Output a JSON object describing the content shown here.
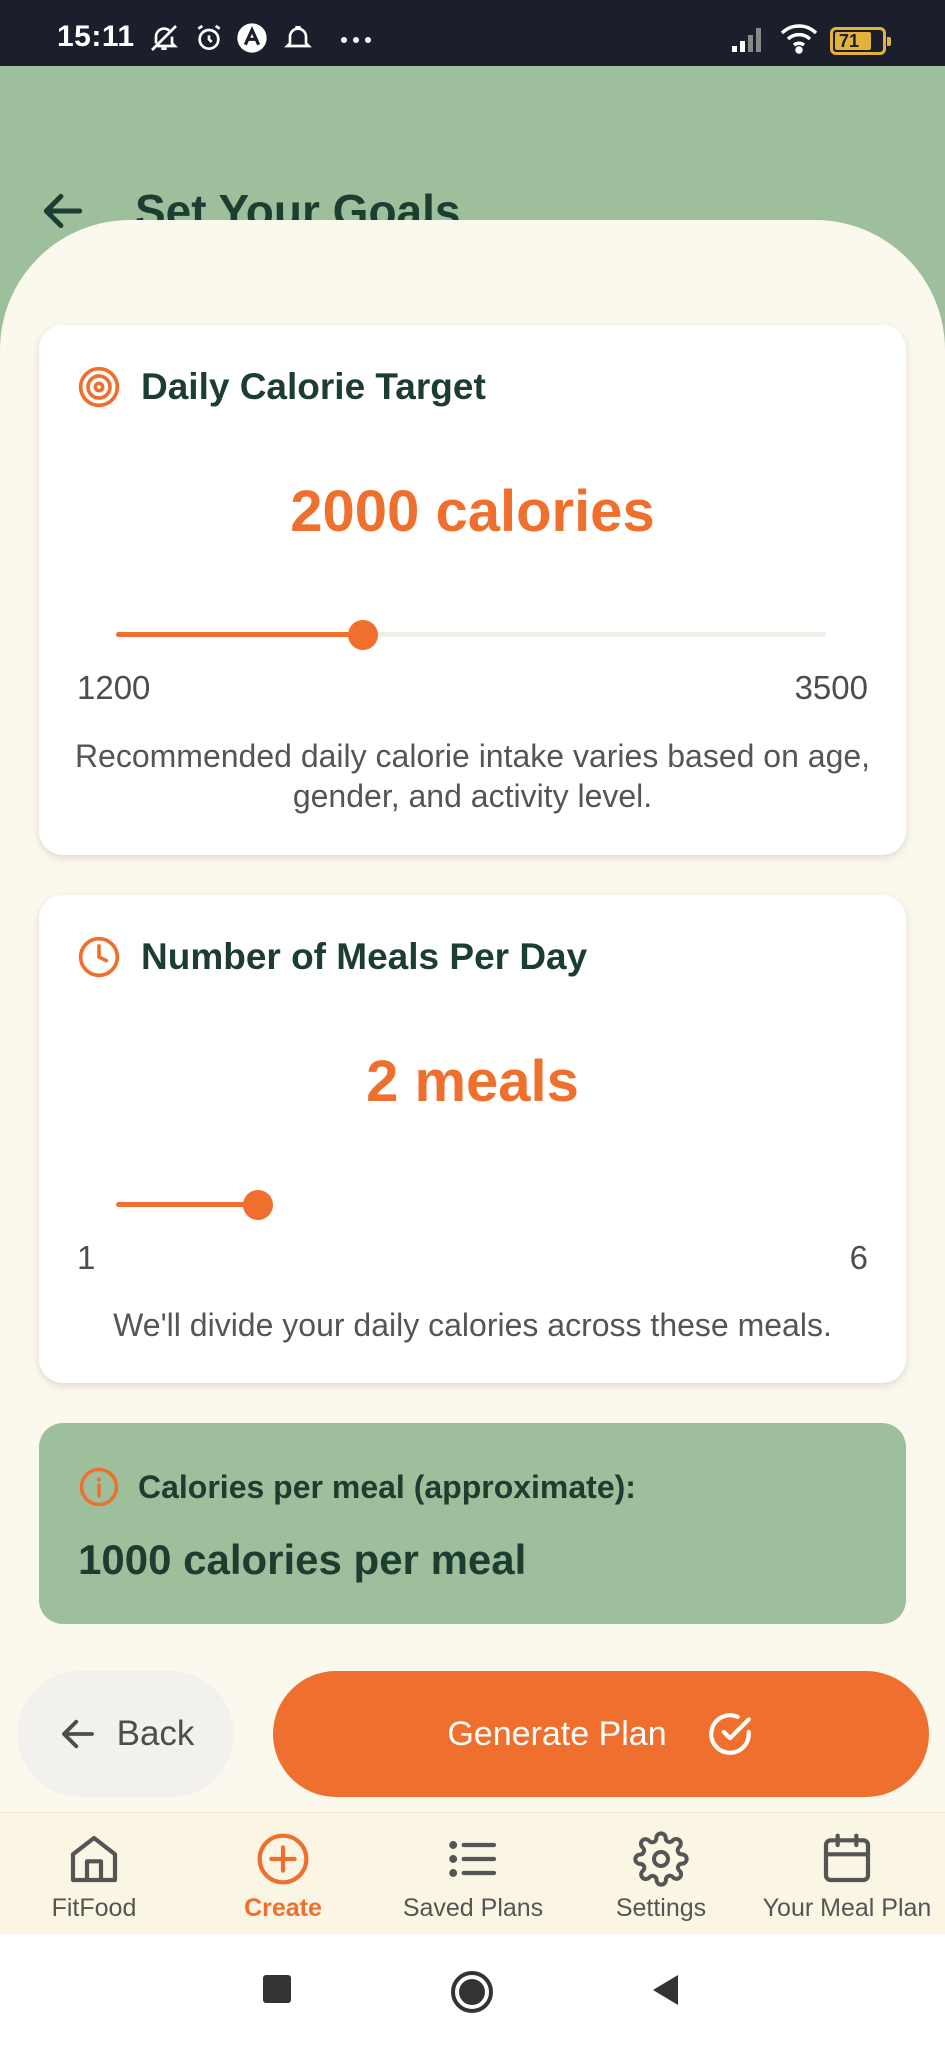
{
  "status_bar": {
    "time": "15:11",
    "battery": "71"
  },
  "header": {
    "title": "Set Your Goals"
  },
  "calorie_card": {
    "title": "Daily Calorie Target",
    "value_text": "2000 calories",
    "slider": {
      "min": 1200,
      "max": 3500,
      "value": 2000,
      "min_label": "1200",
      "max_label": "3500"
    },
    "description": "Recommended daily calorie intake varies based on age, gender, and activity level."
  },
  "meals_card": {
    "title": "Number of Meals Per Day",
    "value_text": "2 meals",
    "slider": {
      "min": 1,
      "max": 6,
      "value": 2,
      "min_label": "1",
      "max_label": "6"
    },
    "description": "We'll divide your daily calories across these meals."
  },
  "info_box": {
    "label": "Calories per meal (approximate):",
    "value": "1000 calories per meal"
  },
  "actions": {
    "back_label": "Back",
    "generate_label": "Generate Plan"
  },
  "bottom_nav": {
    "items": [
      {
        "label": "FitFood",
        "icon": "home-icon",
        "active": false
      },
      {
        "label": "Create",
        "icon": "plus-circle-icon",
        "active": true
      },
      {
        "label": "Saved Plans",
        "icon": "list-icon",
        "active": false
      },
      {
        "label": "Settings",
        "icon": "gear-icon",
        "active": false
      },
      {
        "label": "Your Meal Plan",
        "icon": "calendar-icon",
        "active": false
      }
    ]
  },
  "colors": {
    "accent": "#ef702e",
    "header_green": "#9dbf9b",
    "dark_green": "#1d3d30",
    "background": "#fbf8ee"
  }
}
